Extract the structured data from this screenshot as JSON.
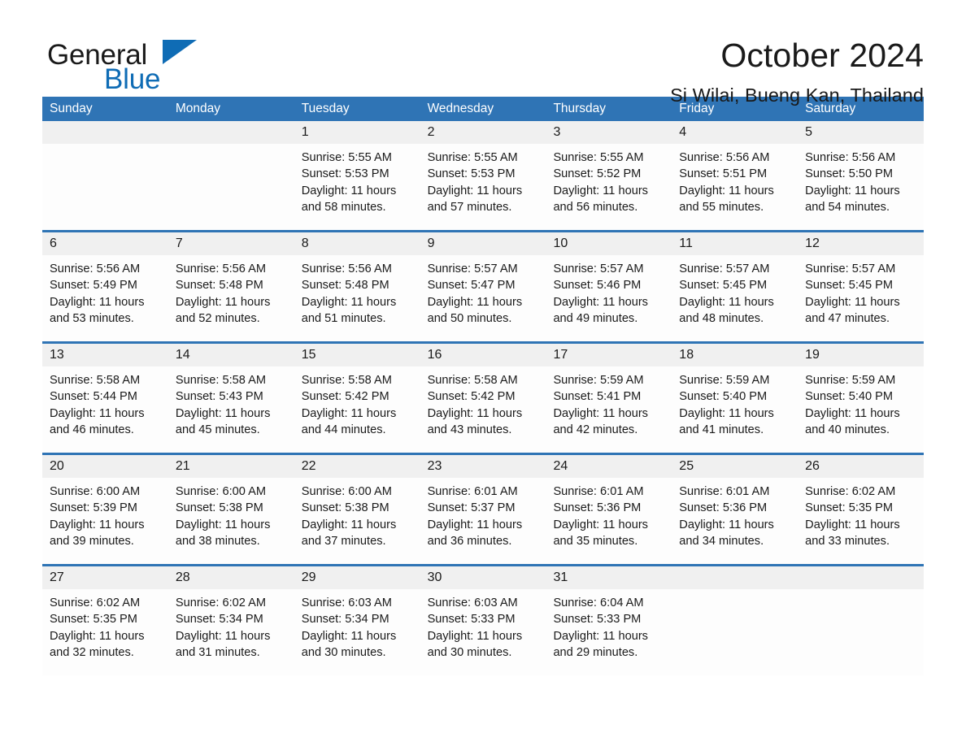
{
  "logo": {
    "word_one": "General",
    "word_two": "Blue",
    "triangle_color": "#0f6cb5"
  },
  "header": {
    "month_title": "October 2024",
    "location": "Si Wilai, Bueng Kan, Thailand"
  },
  "theme": {
    "header_blue": "#2f74b5",
    "row_divider_blue": "#2f74b5",
    "day_band_gray": "#f0f0f0",
    "text_color": "#1a1a1a"
  },
  "calendar": {
    "weekdays": [
      "Sunday",
      "Monday",
      "Tuesday",
      "Wednesday",
      "Thursday",
      "Friday",
      "Saturday"
    ],
    "weeks": [
      [
        {
          "day": "",
          "sunrise": "",
          "sunset": "",
          "daylight_line1": "",
          "daylight_line2": ""
        },
        {
          "day": "",
          "sunrise": "",
          "sunset": "",
          "daylight_line1": "",
          "daylight_line2": ""
        },
        {
          "day": "1",
          "sunrise": "Sunrise: 5:55 AM",
          "sunset": "Sunset: 5:53 PM",
          "daylight_line1": "Daylight: 11 hours",
          "daylight_line2": "and 58 minutes."
        },
        {
          "day": "2",
          "sunrise": "Sunrise: 5:55 AM",
          "sunset": "Sunset: 5:53 PM",
          "daylight_line1": "Daylight: 11 hours",
          "daylight_line2": "and 57 minutes."
        },
        {
          "day": "3",
          "sunrise": "Sunrise: 5:55 AM",
          "sunset": "Sunset: 5:52 PM",
          "daylight_line1": "Daylight: 11 hours",
          "daylight_line2": "and 56 minutes."
        },
        {
          "day": "4",
          "sunrise": "Sunrise: 5:56 AM",
          "sunset": "Sunset: 5:51 PM",
          "daylight_line1": "Daylight: 11 hours",
          "daylight_line2": "and 55 minutes."
        },
        {
          "day": "5",
          "sunrise": "Sunrise: 5:56 AM",
          "sunset": "Sunset: 5:50 PM",
          "daylight_line1": "Daylight: 11 hours",
          "daylight_line2": "and 54 minutes."
        }
      ],
      [
        {
          "day": "6",
          "sunrise": "Sunrise: 5:56 AM",
          "sunset": "Sunset: 5:49 PM",
          "daylight_line1": "Daylight: 11 hours",
          "daylight_line2": "and 53 minutes."
        },
        {
          "day": "7",
          "sunrise": "Sunrise: 5:56 AM",
          "sunset": "Sunset: 5:48 PM",
          "daylight_line1": "Daylight: 11 hours",
          "daylight_line2": "and 52 minutes."
        },
        {
          "day": "8",
          "sunrise": "Sunrise: 5:56 AM",
          "sunset": "Sunset: 5:48 PM",
          "daylight_line1": "Daylight: 11 hours",
          "daylight_line2": "and 51 minutes."
        },
        {
          "day": "9",
          "sunrise": "Sunrise: 5:57 AM",
          "sunset": "Sunset: 5:47 PM",
          "daylight_line1": "Daylight: 11 hours",
          "daylight_line2": "and 50 minutes."
        },
        {
          "day": "10",
          "sunrise": "Sunrise: 5:57 AM",
          "sunset": "Sunset: 5:46 PM",
          "daylight_line1": "Daylight: 11 hours",
          "daylight_line2": "and 49 minutes."
        },
        {
          "day": "11",
          "sunrise": "Sunrise: 5:57 AM",
          "sunset": "Sunset: 5:45 PM",
          "daylight_line1": "Daylight: 11 hours",
          "daylight_line2": "and 48 minutes."
        },
        {
          "day": "12",
          "sunrise": "Sunrise: 5:57 AM",
          "sunset": "Sunset: 5:45 PM",
          "daylight_line1": "Daylight: 11 hours",
          "daylight_line2": "and 47 minutes."
        }
      ],
      [
        {
          "day": "13",
          "sunrise": "Sunrise: 5:58 AM",
          "sunset": "Sunset: 5:44 PM",
          "daylight_line1": "Daylight: 11 hours",
          "daylight_line2": "and 46 minutes."
        },
        {
          "day": "14",
          "sunrise": "Sunrise: 5:58 AM",
          "sunset": "Sunset: 5:43 PM",
          "daylight_line1": "Daylight: 11 hours",
          "daylight_line2": "and 45 minutes."
        },
        {
          "day": "15",
          "sunrise": "Sunrise: 5:58 AM",
          "sunset": "Sunset: 5:42 PM",
          "daylight_line1": "Daylight: 11 hours",
          "daylight_line2": "and 44 minutes."
        },
        {
          "day": "16",
          "sunrise": "Sunrise: 5:58 AM",
          "sunset": "Sunset: 5:42 PM",
          "daylight_line1": "Daylight: 11 hours",
          "daylight_line2": "and 43 minutes."
        },
        {
          "day": "17",
          "sunrise": "Sunrise: 5:59 AM",
          "sunset": "Sunset: 5:41 PM",
          "daylight_line1": "Daylight: 11 hours",
          "daylight_line2": "and 42 minutes."
        },
        {
          "day": "18",
          "sunrise": "Sunrise: 5:59 AM",
          "sunset": "Sunset: 5:40 PM",
          "daylight_line1": "Daylight: 11 hours",
          "daylight_line2": "and 41 minutes."
        },
        {
          "day": "19",
          "sunrise": "Sunrise: 5:59 AM",
          "sunset": "Sunset: 5:40 PM",
          "daylight_line1": "Daylight: 11 hours",
          "daylight_line2": "and 40 minutes."
        }
      ],
      [
        {
          "day": "20",
          "sunrise": "Sunrise: 6:00 AM",
          "sunset": "Sunset: 5:39 PM",
          "daylight_line1": "Daylight: 11 hours",
          "daylight_line2": "and 39 minutes."
        },
        {
          "day": "21",
          "sunrise": "Sunrise: 6:00 AM",
          "sunset": "Sunset: 5:38 PM",
          "daylight_line1": "Daylight: 11 hours",
          "daylight_line2": "and 38 minutes."
        },
        {
          "day": "22",
          "sunrise": "Sunrise: 6:00 AM",
          "sunset": "Sunset: 5:38 PM",
          "daylight_line1": "Daylight: 11 hours",
          "daylight_line2": "and 37 minutes."
        },
        {
          "day": "23",
          "sunrise": "Sunrise: 6:01 AM",
          "sunset": "Sunset: 5:37 PM",
          "daylight_line1": "Daylight: 11 hours",
          "daylight_line2": "and 36 minutes."
        },
        {
          "day": "24",
          "sunrise": "Sunrise: 6:01 AM",
          "sunset": "Sunset: 5:36 PM",
          "daylight_line1": "Daylight: 11 hours",
          "daylight_line2": "and 35 minutes."
        },
        {
          "day": "25",
          "sunrise": "Sunrise: 6:01 AM",
          "sunset": "Sunset: 5:36 PM",
          "daylight_line1": "Daylight: 11 hours",
          "daylight_line2": "and 34 minutes."
        },
        {
          "day": "26",
          "sunrise": "Sunrise: 6:02 AM",
          "sunset": "Sunset: 5:35 PM",
          "daylight_line1": "Daylight: 11 hours",
          "daylight_line2": "and 33 minutes."
        }
      ],
      [
        {
          "day": "27",
          "sunrise": "Sunrise: 6:02 AM",
          "sunset": "Sunset: 5:35 PM",
          "daylight_line1": "Daylight: 11 hours",
          "daylight_line2": "and 32 minutes."
        },
        {
          "day": "28",
          "sunrise": "Sunrise: 6:02 AM",
          "sunset": "Sunset: 5:34 PM",
          "daylight_line1": "Daylight: 11 hours",
          "daylight_line2": "and 31 minutes."
        },
        {
          "day": "29",
          "sunrise": "Sunrise: 6:03 AM",
          "sunset": "Sunset: 5:34 PM",
          "daylight_line1": "Daylight: 11 hours",
          "daylight_line2": "and 30 minutes."
        },
        {
          "day": "30",
          "sunrise": "Sunrise: 6:03 AM",
          "sunset": "Sunset: 5:33 PM",
          "daylight_line1": "Daylight: 11 hours",
          "daylight_line2": "and 30 minutes."
        },
        {
          "day": "31",
          "sunrise": "Sunrise: 6:04 AM",
          "sunset": "Sunset: 5:33 PM",
          "daylight_line1": "Daylight: 11 hours",
          "daylight_line2": "and 29 minutes."
        },
        {
          "day": "",
          "sunrise": "",
          "sunset": "",
          "daylight_line1": "",
          "daylight_line2": ""
        },
        {
          "day": "",
          "sunrise": "",
          "sunset": "",
          "daylight_line1": "",
          "daylight_line2": ""
        }
      ]
    ]
  }
}
